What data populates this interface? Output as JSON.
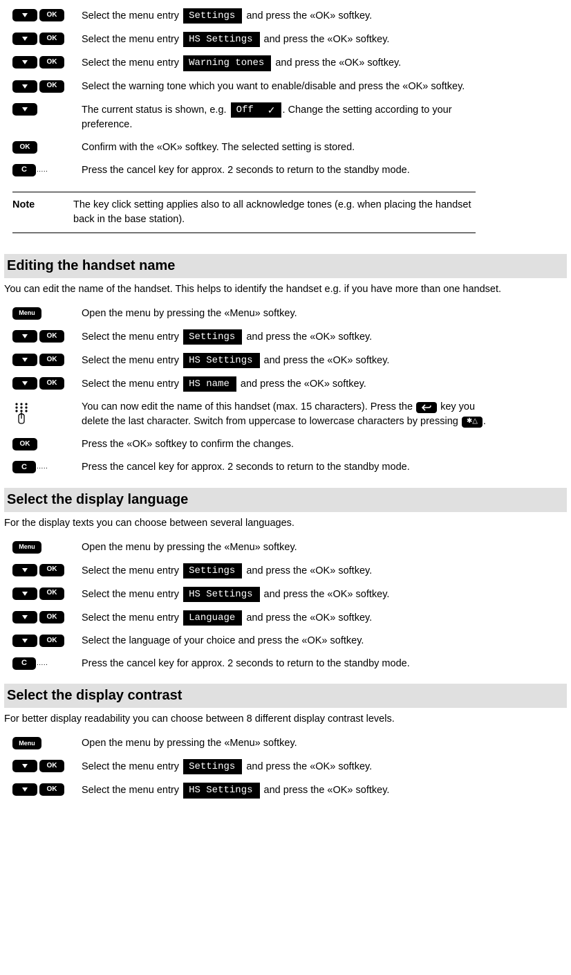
{
  "keys": {
    "ok": "OK",
    "menu": "Menu",
    "c": "C"
  },
  "chips": {
    "settings": "Settings",
    "hs_settings": "HS Settings",
    "warning_tones": "Warning tones",
    "off": "Off",
    "hs_name": "HS name",
    "language": "Language"
  },
  "inline": {
    "star": "✱△"
  },
  "sec0": {
    "step1a": "Select the menu entry ",
    "step1b": " and press the «OK» softkey.",
    "step2a": "Select the menu entry ",
    "step2b": " and press the «OK» softkey.",
    "step3a": "Select the menu entry ",
    "step3b": " and press the «OK» softkey.",
    "step4": "Select the warning tone which you want to enable/disable and press the «OK» softkey.",
    "step5a": "The current status is shown, e.g. ",
    "step5b": ". Change the setting according to your preference.",
    "step6": "Confirm with the «OK» softkey. The selected setting is stored.",
    "step7": "Press the cancel key for approx. 2 seconds to return to the standby mode."
  },
  "note": {
    "label": "Note",
    "text": "The key click setting applies also to all acknowledge tones (e.g. when placing the handset back in the base station)."
  },
  "sec1": {
    "heading": "Editing the handset name",
    "intro": "You can edit the name of the handset. This helps to identify the handset e.g. if you have more than one handset.",
    "s1": "Open the menu by pressing the «Menu» softkey.",
    "s2a": "Select the menu entry ",
    "s2b": " and press the «OK» softkey.",
    "s3a": "Select the menu entry ",
    "s3b": " and press the «OK» softkey.",
    "s4a": "Select the menu entry ",
    "s4b": " and press the «OK» softkey.",
    "s5a": "You can now edit the name of this handset (max. 15 characters). Press the ",
    "s5b": " key you delete the last character. Switch from uppercase to lowercase characters by pressing ",
    "s5c": ".",
    "s6": "Press the «OK» softkey to confirm the changes.",
    "s7": "Press the cancel key for approx. 2 seconds to return to the standby mode."
  },
  "sec2": {
    "heading": "Select the display language",
    "intro": "For the display texts you can choose between several languages.",
    "s1": "Open the menu by pressing the «Menu» softkey.",
    "s2a": "Select the menu entry ",
    "s2b": " and press the «OK» softkey.",
    "s3a": "Select the menu entry ",
    "s3b": " and press the «OK» softkey.",
    "s4a": "Select the menu entry ",
    "s4b": " and press the «OK» softkey.",
    "s5": "Select the language of your choice and press the «OK» softkey.",
    "s6": "Press the cancel key for approx. 2 seconds to return to the standby mode."
  },
  "sec3": {
    "heading": "Select the display contrast",
    "intro": "For better display readability you can choose between 8 different display contrast levels.",
    "s1": "Open the menu by pressing the «Menu» softkey.",
    "s2a": "Select the menu entry ",
    "s2b": " and press the «OK» softkey.",
    "s3a": "Select the menu entry ",
    "s3b": " and press the «OK» softkey."
  }
}
